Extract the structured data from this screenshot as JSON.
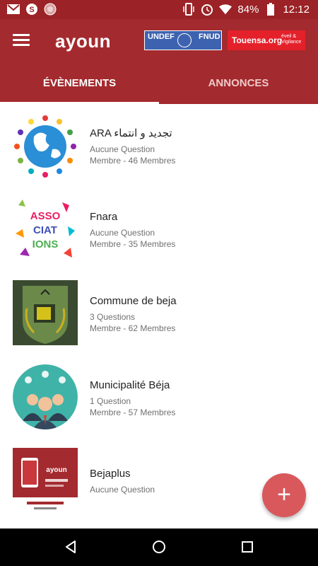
{
  "status_bar": {
    "battery": "84%",
    "time": "12:12",
    "icons_left": [
      "gmail-icon",
      "skype-icon",
      "circle-app-icon"
    ],
    "icons_right": [
      "vibrate-icon",
      "alarm-icon",
      "wifi-icon",
      "battery-icon"
    ]
  },
  "app_bar": {
    "logo": "ayoun",
    "partner1_left": "UNDEF",
    "partner1_right": "FNUD",
    "partner2_name": "Touensa.org",
    "partner2_tagline": "éveil & Vigilance"
  },
  "tabs": [
    {
      "label": "ÉVÈNEMENTS",
      "active": true
    },
    {
      "label": "ANNONCES",
      "active": false
    }
  ],
  "items": [
    {
      "title": "ARA تجديد و انتماء",
      "questions": "Aucune Question",
      "members": "Membre - 46 Membres"
    },
    {
      "title": "Fnara",
      "questions": "Aucune Question",
      "members": "Membre - 35 Membres"
    },
    {
      "title": "Commune de beja",
      "questions": "3 Questions",
      "members": "Membre - 62 Membres"
    },
    {
      "title": "Municipalité Béja",
      "questions": "1 Question",
      "members": "Membre - 57 Membres"
    },
    {
      "title": "Bejaplus",
      "questions": "Aucune Question",
      "members": ""
    }
  ],
  "thumb_texts": {
    "assoc_lines": [
      "ASSO",
      "CIAT",
      "IONS"
    ],
    "bejaplus_brand": "ayoun"
  },
  "fab": {
    "label": "+"
  },
  "colors": {
    "primary": "#a32a2e",
    "status_bar": "#9b2226",
    "fab": "#d9585c",
    "touensa": "#e4212b",
    "undef": "#3d63b0"
  }
}
